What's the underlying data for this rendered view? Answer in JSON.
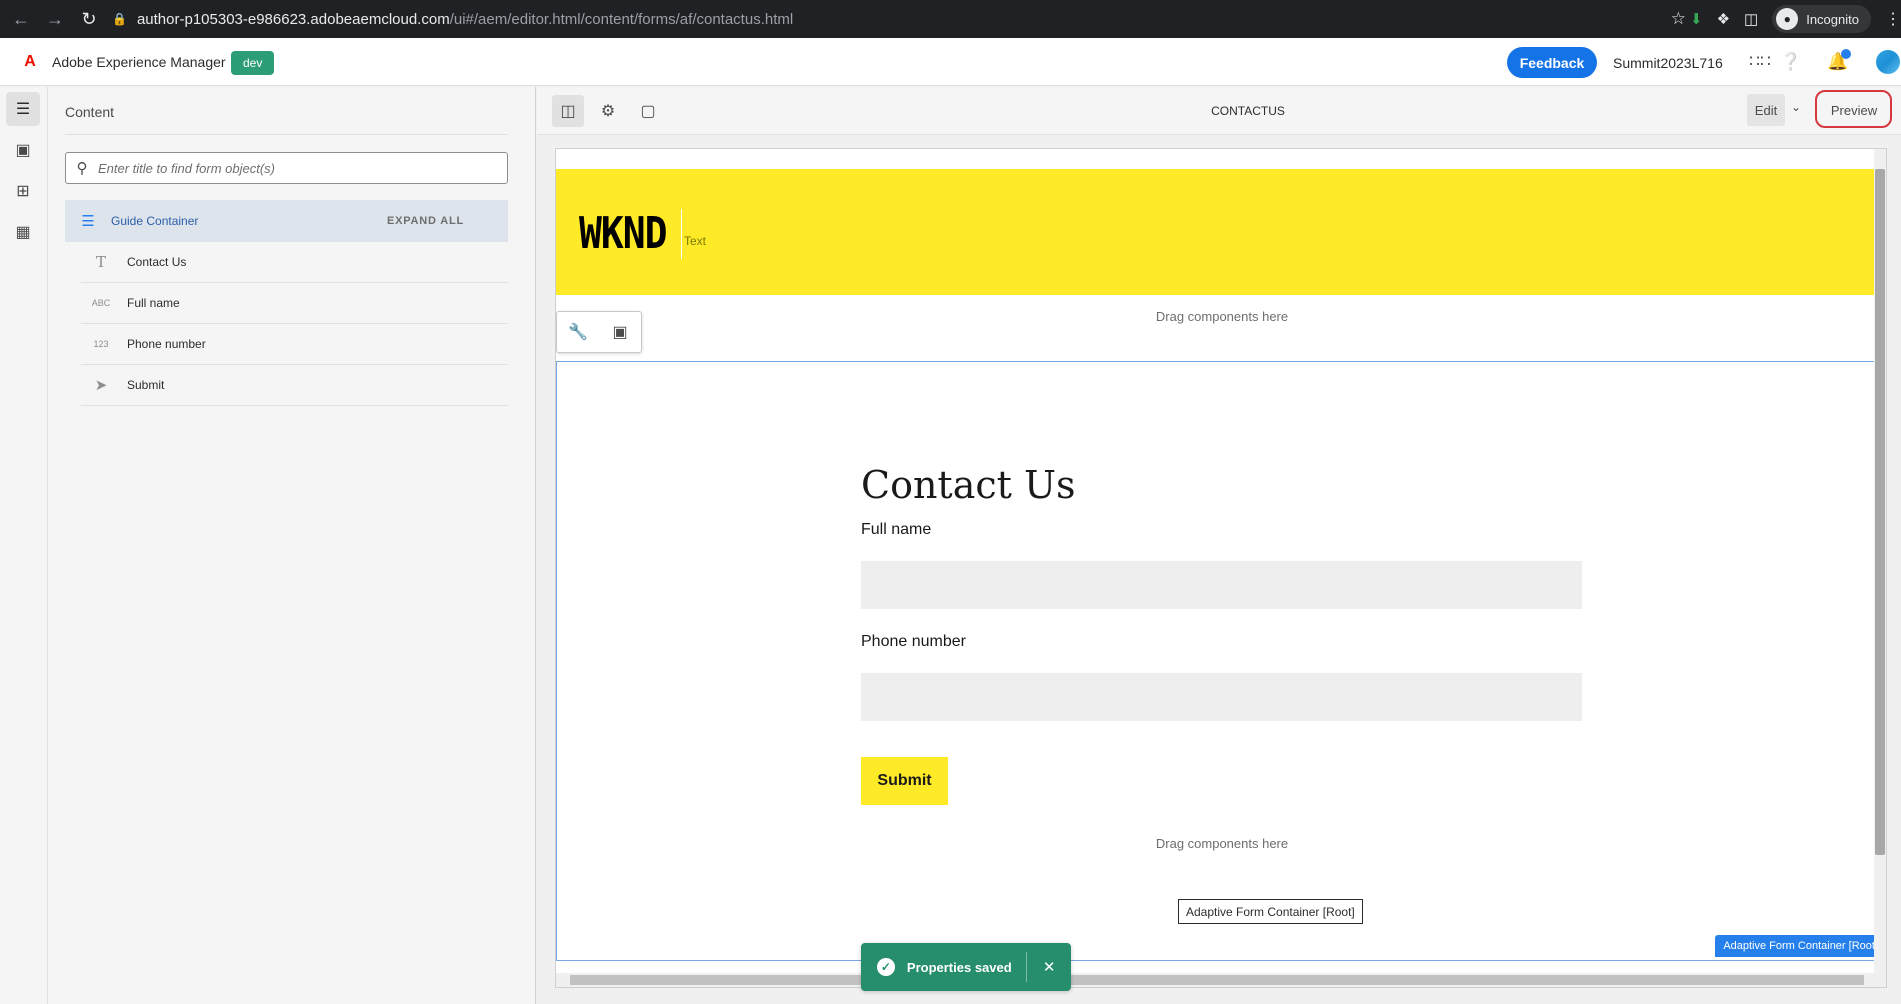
{
  "browser": {
    "url_host": "author-p105303-e986623.adobeaemcloud.com",
    "url_path": "/ui#/aem/editor.html/content/forms/af/contactus.html",
    "profile_label": "Incognito",
    "icons": [
      "back-icon",
      "forward-icon",
      "reload-icon",
      "lock-icon",
      "star-icon",
      "download-icon",
      "extensions-icon",
      "sidepanel-icon",
      "incognito-icon",
      "menu-icon"
    ]
  },
  "header": {
    "app_name": "Adobe Experience Manager",
    "env_badge": "dev",
    "feedback_label": "Feedback",
    "org_name": "Summit2023L716",
    "colors": {
      "env_badge": "#2d9d78",
      "feedback": "#1473e6",
      "adobe_logo": "#eb1000"
    }
  },
  "left_rail": {
    "icons": [
      "content-tree-icon",
      "assets-icon",
      "components-icon",
      "data-sources-icon"
    ]
  },
  "content_panel": {
    "title": "Content",
    "search_placeholder": "Enter title to find form object(s)",
    "root_label": "Guide Container",
    "expand_all_label": "EXPAND ALL",
    "items": [
      {
        "label": "Contact Us",
        "icon_text": "T"
      },
      {
        "label": "Full name",
        "icon_text": "ABC"
      },
      {
        "label": "Phone number",
        "icon_text": "123"
      },
      {
        "label": "Submit",
        "icon_text": "➤"
      }
    ]
  },
  "toolbar": {
    "page_name": "CONTACTUS",
    "edit_label": "Edit",
    "preview_label": "Preview",
    "colors": {
      "highlight_ring": "#d7373f"
    }
  },
  "canvas": {
    "logo_text": "WKND",
    "banner_text": "Text",
    "drag_top": "Drag components here",
    "form_title": "Contact Us",
    "fields": [
      {
        "label": "Full name"
      },
      {
        "label": "Phone number"
      }
    ],
    "submit_label": "Submit",
    "drag_bottom": "Drag components here",
    "root_chip": "Adaptive Form Container [Root]",
    "root_tag": "Adaptive Form Container [Root]",
    "colors": {
      "banner": "#ffea28",
      "submit": "#ffea28",
      "root_tag": "#2680eb"
    }
  },
  "toast": {
    "message": "Properties saved",
    "close_glyph": "✕",
    "colors": {
      "background": "#268e6c"
    }
  }
}
